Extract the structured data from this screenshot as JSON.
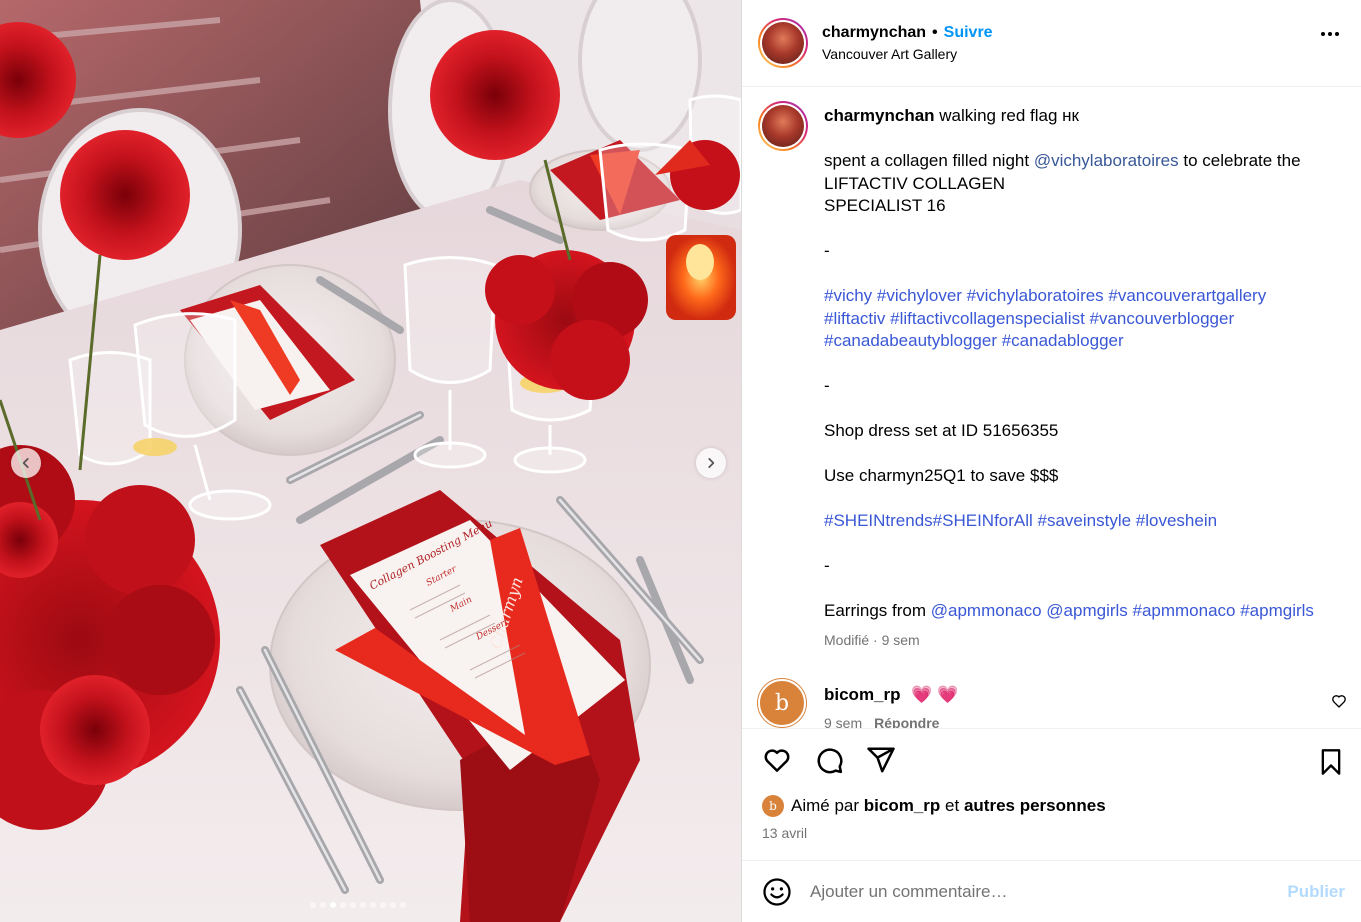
{
  "media": {
    "menu_card_title": "Collagen Boosting Menu",
    "menu_card_sections": [
      "Starter",
      "Main",
      "Dessert"
    ],
    "v_card_text": "Charmyn",
    "carousel": {
      "dot_count": 10,
      "active_index": 2
    }
  },
  "header": {
    "username": "charmynchan",
    "separator": "•",
    "follow_label": "Suivre",
    "location": "Vancouver Art Gallery"
  },
  "caption": {
    "username": "charmynchan",
    "first_line": "walking red flag нк",
    "p1_text": "spent a collagen filled night ",
    "p1_mention": "@vichylaboratoires",
    "p1_rest": " to celebrate the\nLIFTACTIV COLLAGEN\nSPECIALIST 16",
    "dash1": "-",
    "hashtags1": "#vichy #vichylover #vichylaboratoires #vancouverartgallery\n#liftactiv #liftactivcollagenspecialist #vancouverblogger\n#canadabeautyblogger #canadablogger",
    "dash2": "-",
    "shop_line": "Shop dress set at ID 51656355",
    "code_line": "Use charmyn25Q1 to save $$$",
    "hashtags2": "#SHEINtrends#SHEINforAll #saveinstyle #loveshein",
    "dash3": "-",
    "earrings_text": "Earrings from ",
    "earrings_links": "@apmmonaco @apmgirls #apmmonaco #apmgirls",
    "meta": "Modifié · 9 sem"
  },
  "comment": {
    "avatar_letter": "b",
    "username": "bicom_rp",
    "text": "💗 💗",
    "age": "9 sem",
    "reply_label": "Répondre"
  },
  "actions": {
    "liked_prefix": "Aimé par ",
    "liked_user": "bicom_rp",
    "liked_and": " et ",
    "liked_others": "autres personnes",
    "avatar_letter": "b",
    "date": "13 avril"
  },
  "add_comment": {
    "placeholder": "Ajouter un commentaire…",
    "publish_label": "Publier"
  },
  "colors": {
    "follow_blue": "#0095f6",
    "link_blue": "#385898",
    "muted": "#737373",
    "publish_disabled": "#b3dbff",
    "heart_pink": "#e0245e",
    "avatar_orange": "#d9823a"
  },
  "icons": [
    "chevron-left-icon",
    "chevron-right-icon",
    "more-icon",
    "heart-icon",
    "comment-icon",
    "share-icon",
    "bookmark-icon",
    "emoji-icon"
  ]
}
